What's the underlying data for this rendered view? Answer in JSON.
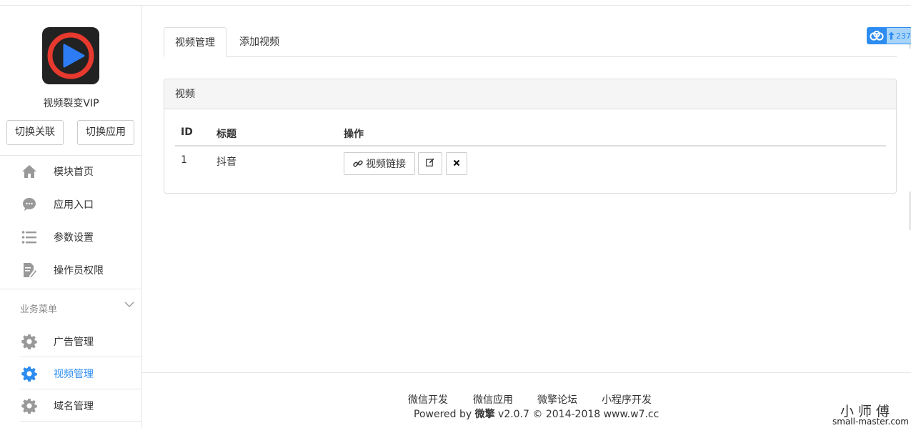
{
  "sidebar": {
    "app_name": "视频裂变VIP",
    "buttons": {
      "switch_link": "切换关联",
      "switch_app": "切换应用"
    },
    "nav": [
      {
        "label": "模块首页",
        "icon": "home-icon"
      },
      {
        "label": "应用入口",
        "icon": "chat-bubble-icon"
      },
      {
        "label": "参数设置",
        "icon": "list-settings-icon"
      },
      {
        "label": "操作员权限",
        "icon": "edit-document-icon"
      }
    ],
    "section_title": "业务菜单",
    "business_nav": [
      {
        "label": "广告管理",
        "icon": "gear-icon",
        "active": false
      },
      {
        "label": "视频管理",
        "icon": "gear-icon",
        "active": true
      },
      {
        "label": "域名管理",
        "icon": "gear-icon",
        "active": false
      }
    ]
  },
  "tabs": [
    {
      "label": "视频管理",
      "active": true
    },
    {
      "label": "添加视频",
      "active": false
    }
  ],
  "panel": {
    "title": "视频",
    "columns": [
      "ID",
      "标题",
      "操作"
    ],
    "rows": [
      {
        "id": "1",
        "title": "抖音",
        "link_label": "视频链接"
      }
    ]
  },
  "cloud_badge": {
    "count": "237"
  },
  "footer": {
    "links": [
      "微信开发",
      "微信应用",
      "微擎论坛",
      "小程序开发"
    ],
    "powered_prefix": "Powered by ",
    "powered_brand": "微擎",
    "powered_suffix": " v2.0.7 © 2014-2018 www.w7.cc"
  },
  "watermark": {
    "cn": "小师傅",
    "en": "small-master.com"
  },
  "colors": {
    "accent": "#2d8cf0",
    "border": "#dddddd"
  }
}
